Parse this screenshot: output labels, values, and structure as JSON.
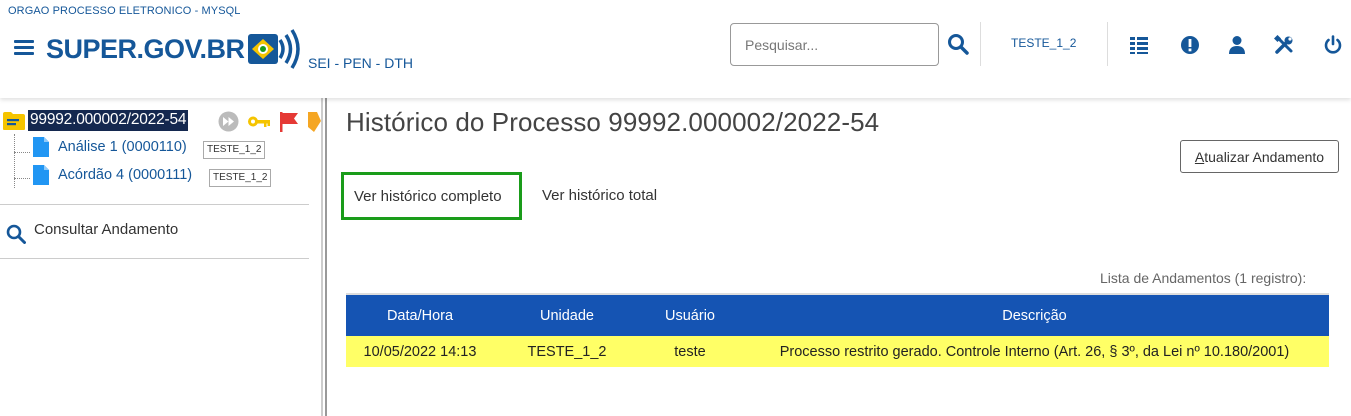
{
  "header": {
    "org_name": "ORGAO PROCESSO ELETRONICO - MYSQL",
    "logo_text": "SUPER.GOV.BR",
    "system_name": "SEI - PEN - DTH",
    "search_placeholder": "Pesquisar...",
    "unit": "TESTE_1_2",
    "icons": [
      "menu-icon",
      "search-icon",
      "control-list-icon",
      "alert-icon",
      "user-icon",
      "tools-icon",
      "power-icon"
    ],
    "accent_color": "#155799"
  },
  "tree": {
    "root": {
      "label": "99992.000002/2022-54",
      "icons": [
        "folder-icon",
        "fast-forward-icon",
        "key-icon",
        "flag-icon",
        "tag-icon"
      ]
    },
    "documents": [
      {
        "label": "Análise 1 (0000110)",
        "unit": "TESTE_1_2"
      },
      {
        "label": "Acórdão 4 (0000111)",
        "unit": "TESTE_1_2"
      }
    ]
  },
  "sidebar": {
    "consult_label": "Consultar Andamento"
  },
  "main": {
    "title": "Histórico do Processo 99992.000002/2022-54",
    "refresh_button": {
      "accesskey": "A",
      "rest": "tualizar Andamento"
    },
    "tabs": [
      {
        "label": "Ver histórico completo",
        "selected": true
      },
      {
        "label": "Ver histórico total",
        "selected": false
      }
    ],
    "table": {
      "caption": "Lista de Andamentos (1 registro):",
      "columns": [
        "Data/Hora",
        "Unidade",
        "Usuário",
        "Descrição"
      ],
      "rows": [
        [
          "10/05/2022 14:13",
          "TESTE_1_2",
          "teste",
          "Processo restrito gerado. Controle Interno (Art. 26, § 3º, da Lei nº 10.180/2001)"
        ]
      ],
      "header_color": "#1554b3",
      "row_highlight_color": "#ffff66"
    }
  }
}
